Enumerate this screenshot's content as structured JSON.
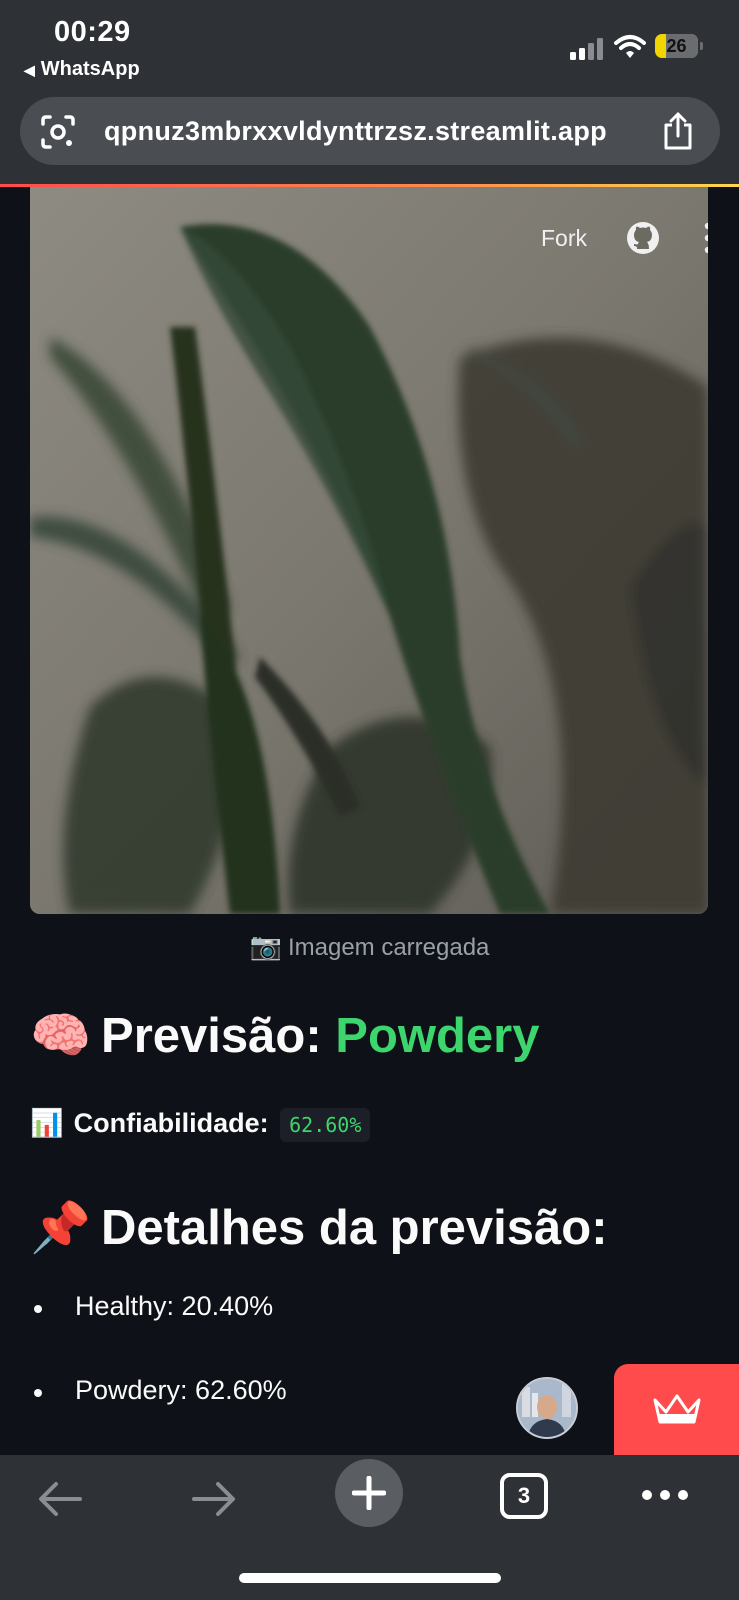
{
  "status_bar": {
    "time": "00:29",
    "back_app": "WhatsApp",
    "battery_level": "26",
    "battery_fraction": 0.26
  },
  "browser": {
    "url": "qpnuz3mbrxxvldynttrzsz.streamlit.app",
    "tab_count": "3"
  },
  "app_toolbar": {
    "fork_label": "Fork"
  },
  "image": {
    "caption_emoji": "📷",
    "caption": "Imagem carregada"
  },
  "prediction": {
    "emoji": "🧠",
    "label": "Previsão:",
    "value": "Powdery",
    "value_color": "#3dd56d"
  },
  "confidence": {
    "emoji": "📊",
    "label": "Confiabilidade:",
    "value": "62.60%"
  },
  "details": {
    "emoji": "📌",
    "title": "Detalhes da previsão:",
    "items": [
      {
        "label": "Healthy: 20.40%"
      },
      {
        "label": "Powdery: 62.60%"
      }
    ]
  },
  "colors": {
    "background": "#0e1117",
    "streamlit_red": "#ff4b4b",
    "browser_chrome": "#2e3135"
  },
  "icons": {
    "status": [
      "signal-icon",
      "wifi-icon",
      "battery-icon"
    ],
    "browser_top": [
      "lens-icon",
      "share-icon"
    ],
    "app_toolbar": [
      "github-icon",
      "kebab-menu-icon"
    ],
    "bottom_toolbar": [
      "back-arrow-icon",
      "forward-arrow-icon",
      "plus-icon",
      "tabs-icon",
      "more-dots-icon"
    ],
    "badge": "crown-icon"
  }
}
